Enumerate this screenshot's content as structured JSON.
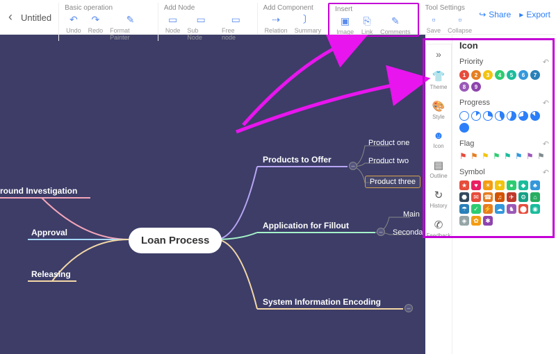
{
  "title": "Untitled",
  "toolbar": {
    "basic": {
      "label": "Basic operation",
      "undo": "Undo",
      "redo": "Redo",
      "fmt": "Format Painter"
    },
    "addnode": {
      "label": "Add Node",
      "node": "Node",
      "sub": "Sub Node",
      "free": "Free node"
    },
    "addcomp": {
      "label": "Add Component",
      "rel": "Relation",
      "sum": "Summary"
    },
    "insert": {
      "label": "Insert",
      "img": "Image",
      "link": "Link",
      "com": "Comments"
    },
    "tool": {
      "label": "Tool Settings",
      "save": "Save",
      "col": "Collapse"
    },
    "share": "Share",
    "export": "Export"
  },
  "mindmap": {
    "center": "Loan Process",
    "left": {
      "a": "round Investigation",
      "b": "Approval",
      "c": "Releasing"
    },
    "right": {
      "products": {
        "label": "Products to Offer",
        "a": "Product one",
        "b": "Product two",
        "c": "Product three"
      },
      "app": {
        "label": "Application for Fillout",
        "a": "Main",
        "b": "Seconda"
      },
      "sys": {
        "label": "System Information Encoding"
      }
    }
  },
  "tabs": {
    "theme": "Theme",
    "style": "Style",
    "icon": "Icon",
    "outline": "Outline",
    "history": "History",
    "feedback": "Feedback"
  },
  "panel": {
    "title": "Icon",
    "priority": "Priority",
    "progress": "Progress",
    "flag": "Flag",
    "symbol": "Symbol"
  }
}
